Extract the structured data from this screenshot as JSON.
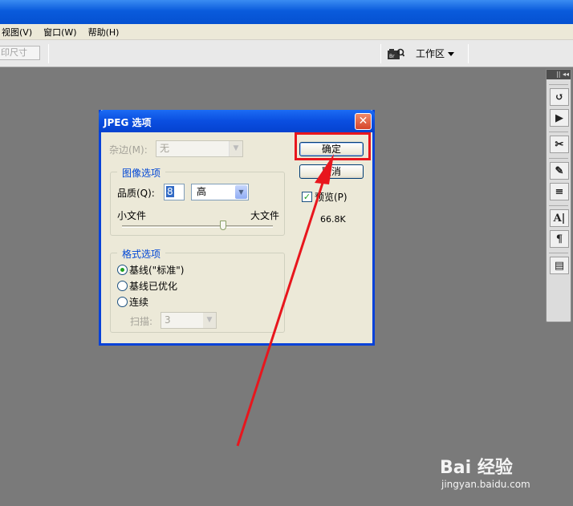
{
  "menubar": {
    "items": [
      "视图(V)",
      "窗口(W)",
      "帮助(H)"
    ]
  },
  "optionsbar": {
    "print_size_label": "印尺寸",
    "bridge_icon": "bridge-camera-icon",
    "workspace_label": "工作区"
  },
  "right_panel": {
    "header_glyph": "|| ◂◂",
    "buttons": [
      {
        "icon": "history-icon",
        "glyph": "↺"
      },
      {
        "icon": "actions-play-icon",
        "glyph": "▶"
      },
      {
        "icon": "tools-icon",
        "glyph": "✂"
      },
      {
        "icon": "brushes-icon",
        "glyph": "✎"
      },
      {
        "icon": "tool-presets-icon",
        "glyph": "≡"
      },
      {
        "icon": "character-icon",
        "glyph": "A|"
      },
      {
        "icon": "paragraph-icon",
        "glyph": "¶"
      },
      {
        "icon": "layer-comps-icon",
        "glyph": "▤"
      }
    ]
  },
  "dialog": {
    "title": "JPEG 选项",
    "close_glyph": "✕",
    "matte_label": "杂边(M):",
    "matte_value": "无",
    "image_options": {
      "legend": "图像选项",
      "quality_label": "品质(Q):",
      "quality_value": "8",
      "quality_level": "高",
      "small_file": "小文件",
      "large_file": "大文件",
      "slider_fraction": 0.67
    },
    "format_options": {
      "legend": "格式选项",
      "baseline_standard": "基线(\"标准\")",
      "baseline_optimized": "基线已优化",
      "progressive": "连续",
      "scan_label": "扫描:",
      "scan_value": "3",
      "selected": "baseline_standard"
    },
    "ok_label": "确定",
    "cancel_label": "取消",
    "preview_label": "预览(P)",
    "preview_checked": true,
    "file_size": "66.8K"
  },
  "annotation": {
    "arrow_color": "#e8161d",
    "box_color": "#e8161d"
  },
  "watermark": {
    "main": "Bai 经验",
    "sub": "jingyan.baidu.com"
  }
}
